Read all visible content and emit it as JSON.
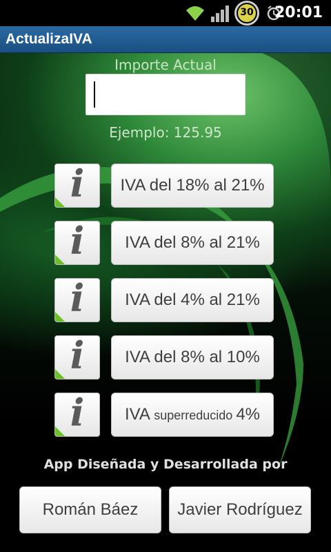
{
  "status_bar": {
    "time": "20:01",
    "battery_level": "30",
    "icons": [
      "wifi-icon",
      "signal-icon",
      "battery-icon",
      "alarm-icon"
    ]
  },
  "app": {
    "title": "ActualizaIVA"
  },
  "amount": {
    "label": "Importe Actual",
    "value": "",
    "example": "Ejemplo: 125.95"
  },
  "rows": [
    {
      "label": "IVA del 18% al 21%"
    },
    {
      "label": "IVA del 8% al 21%"
    },
    {
      "label": "IVA del 4% al 21%"
    },
    {
      "label": "IVA del 8% al 10%"
    },
    {
      "label_prefix": "IVA",
      "label_small": "superreducido",
      "label_suffix": "4%"
    }
  ],
  "info_glyph": "i",
  "credits": {
    "text": "App Diseñada y Desarrollada por",
    "authors": [
      "Román Báez",
      "Javier Rodríguez"
    ]
  },
  "colors": {
    "title_bar": "#1a4f82",
    "accent_green": "#6cc02c",
    "button_text": "#3f3f3f"
  }
}
